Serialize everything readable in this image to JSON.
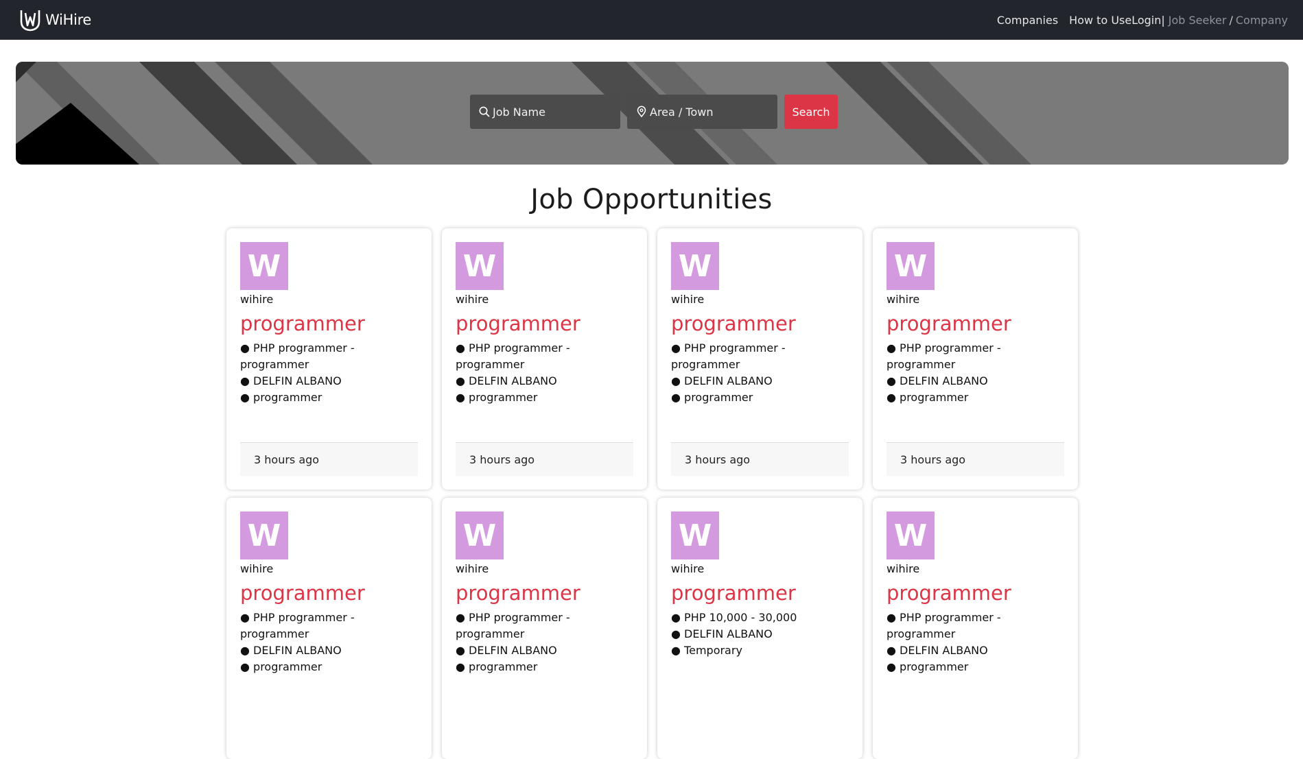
{
  "nav": {
    "brand": "WiHire",
    "companies": "Companies",
    "how_to_use": "How to Use",
    "login": "Login|",
    "job_seeker": "Job Seeker",
    "slash": "/",
    "company": "Company"
  },
  "search": {
    "job_placeholder": "Job Name",
    "area_placeholder": "Area / Town",
    "button": "Search"
  },
  "section_title": "Job Opportunities",
  "colors": {
    "navbar": "#22252b",
    "accent_red": "#dc3545",
    "logo_purple": "#d49ae0"
  },
  "jobs": [
    {
      "logo_letter": "W",
      "company": "wihire",
      "title": "programmer",
      "details": [
        "● PHP programmer - programmer",
        "● DELFIN ALBANO",
        "● programmer"
      ],
      "posted": "3 hours ago"
    },
    {
      "logo_letter": "W",
      "company": "wihire",
      "title": "programmer",
      "details": [
        "● PHP programmer - programmer",
        "● DELFIN ALBANO",
        "● programmer"
      ],
      "posted": "3 hours ago"
    },
    {
      "logo_letter": "W",
      "company": "wihire",
      "title": "programmer",
      "details": [
        "● PHP programmer - programmer",
        "● DELFIN ALBANO",
        "● programmer"
      ],
      "posted": "3 hours ago"
    },
    {
      "logo_letter": "W",
      "company": "wihire",
      "title": "programmer",
      "details": [
        "● PHP programmer - programmer",
        "● DELFIN ALBANO",
        "● programmer"
      ],
      "posted": "3 hours ago"
    },
    {
      "logo_letter": "W",
      "company": "wihire",
      "title": "programmer",
      "details": [
        "● PHP programmer - programmer",
        "● DELFIN ALBANO",
        "● programmer"
      ],
      "posted": ""
    },
    {
      "logo_letter": "W",
      "company": "wihire",
      "title": "programmer",
      "details": [
        "● PHP programmer - programmer",
        "● DELFIN ALBANO",
        "● programmer"
      ],
      "posted": ""
    },
    {
      "logo_letter": "W",
      "company": "wihire",
      "title": "programmer",
      "details": [
        "● PHP 10,000 - 30,000",
        "● DELFIN ALBANO",
        "● Temporary"
      ],
      "posted": ""
    },
    {
      "logo_letter": "W",
      "company": "wihire",
      "title": "programmer",
      "details": [
        "● PHP programmer - programmer",
        "● DELFIN ALBANO",
        "● programmer"
      ],
      "posted": ""
    }
  ]
}
